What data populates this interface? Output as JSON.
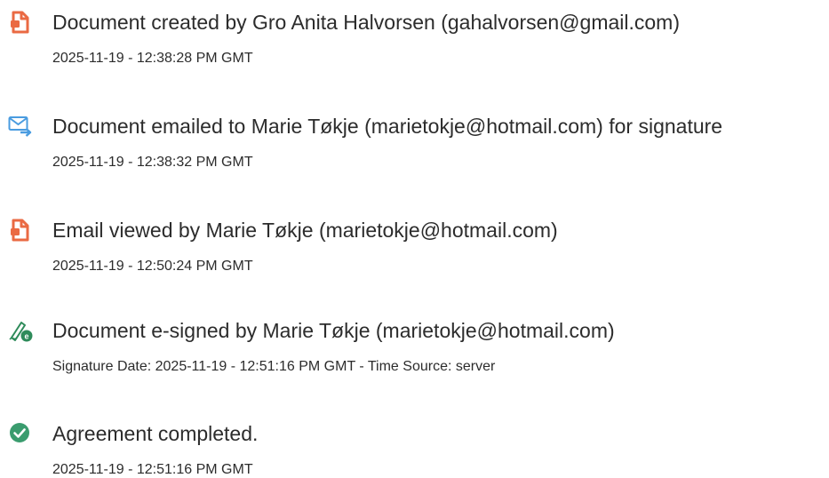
{
  "colors": {
    "doc_icon": "#ea6a43",
    "mail_icon": "#4a9ce0",
    "sign_icon": "#2e8b5a",
    "complete_icon": "#3a9c6e",
    "text": "#2c2c2c"
  },
  "events": [
    {
      "icon": "document-icon",
      "title": "Document created by Gro Anita Halvorsen (gahalvorsen@gmail.com)",
      "meta": "2025-11-19 - 12:38:28 PM GMT"
    },
    {
      "icon": "email-forward-icon",
      "title": "Document emailed to Marie Tøkje (marietokje@hotmail.com) for signature",
      "meta": "2025-11-19 - 12:38:32 PM GMT"
    },
    {
      "icon": "document-icon",
      "title": "Email viewed by Marie Tøkje (marietokje@hotmail.com)",
      "meta": "2025-11-19 - 12:50:24 PM GMT"
    },
    {
      "icon": "e-sign-pen-icon",
      "title": "Document e-signed by Marie Tøkje (marietokje@hotmail.com)",
      "meta": "Signature Date: 2025-11-19 - 12:51:16 PM GMT - Time Source: server"
    },
    {
      "icon": "checkmark-circle-icon",
      "title": "Agreement completed.",
      "meta": "2025-11-19 - 12:51:16 PM GMT"
    }
  ]
}
